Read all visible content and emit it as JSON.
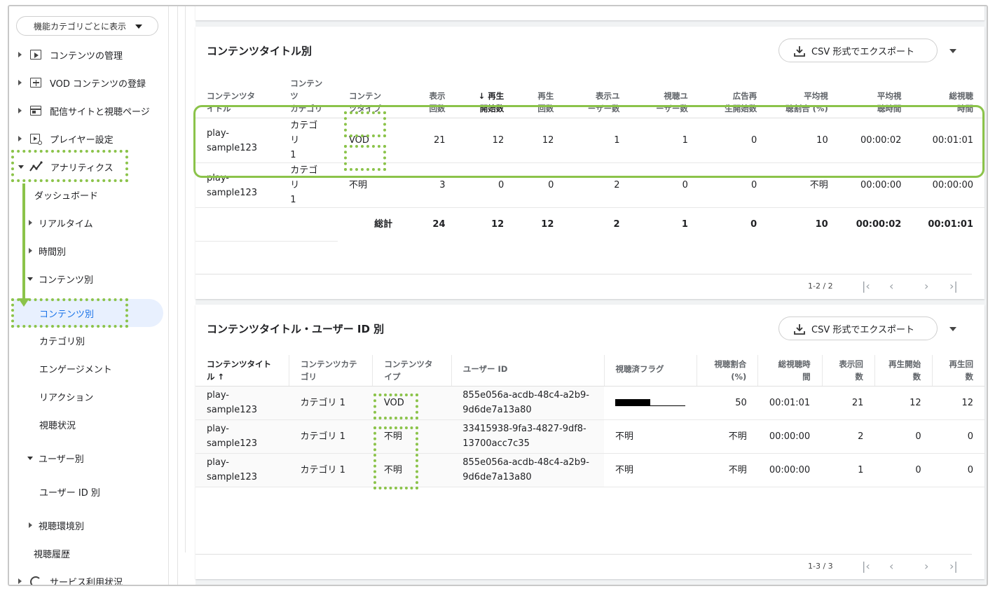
{
  "sidebar": {
    "select_label": "機能カテゴリごとに表示",
    "items": [
      {
        "label": "コンテンツの管理",
        "icon": "play-box-icon"
      },
      {
        "label": "VOD コンテンツの登録",
        "icon": "add-box-icon"
      },
      {
        "label": "配信サイトと視聴ページ",
        "icon": "web-page-icon"
      },
      {
        "label": "プレイヤー設定",
        "icon": "player-settings-icon"
      },
      {
        "label": "アナリティクス",
        "icon": "analytics-icon"
      },
      {
        "label": "ダッシュボード"
      },
      {
        "label": "リアルタイム"
      },
      {
        "label": "時間別"
      },
      {
        "label": "コンテンツ別"
      },
      {
        "label": "コンテンツ別"
      },
      {
        "label": "カテゴリ別"
      },
      {
        "label": "エンゲージメント"
      },
      {
        "label": "リアクション"
      },
      {
        "label": "視聴状況"
      },
      {
        "label": "ユーザー別"
      },
      {
        "label": "ユーザー ID 別"
      },
      {
        "label": "視聴環境別"
      },
      {
        "label": "視聴履歴"
      },
      {
        "label": "サービス利用状況",
        "icon": "service-usage-icon"
      }
    ]
  },
  "card1": {
    "title": "コンテンツタイトル別",
    "csv_label": "CSV 形式でエクスポート",
    "headers": [
      [
        "コンテンツタ",
        "イトル"
      ],
      [
        "コンテンツ",
        "カテゴリ"
      ],
      [
        "コンテン",
        "ツタイプ"
      ],
      [
        "表示",
        "回数"
      ],
      [
        "↓ 再生",
        "開始数"
      ],
      [
        "再生",
        "回数"
      ],
      [
        "表示ユ",
        "ーザー数"
      ],
      [
        "視聴ユ",
        "ーザー数"
      ],
      [
        "広告再",
        "生開始数"
      ],
      [
        "平均視",
        "聴割合 (%)"
      ],
      [
        "平均視",
        "聴時間"
      ],
      [
        "総視聴",
        "時間"
      ]
    ],
    "rows": [
      [
        "play-",
        "sample123",
        "カテゴリ",
        "1",
        "VOD",
        "21",
        "12",
        "12",
        "1",
        "1",
        "0",
        "10",
        "00:00:02",
        "00:01:01"
      ],
      [
        "play-",
        "sample123",
        "カテゴリ",
        "1",
        "不明",
        "3",
        "0",
        "0",
        "2",
        "0",
        "0",
        "不明",
        "00:00:00",
        "00:00:00"
      ]
    ],
    "total": [
      "総計",
      "24",
      "12",
      "12",
      "2",
      "1",
      "0",
      "10",
      "00:00:02",
      "00:01:01"
    ],
    "pager": "1-2 / 2"
  },
  "card2": {
    "title": "コンテンツタイトル・ユーザー ID 別",
    "csv_label": "CSV 形式でエクスポート",
    "headers": [
      [
        "コンテンツタイト",
        "ル ↑"
      ],
      [
        "コンテンツカテ",
        "ゴリ"
      ],
      [
        "コンテンツタ",
        "イプ"
      ],
      [
        "ユーザー ID",
        ""
      ],
      [
        "視聴済フラグ",
        ""
      ],
      [
        "視聴割合",
        "(%)"
      ],
      [
        "総視聴時",
        "間"
      ],
      [
        "表示回",
        "数"
      ],
      [
        "再生開始",
        "数"
      ],
      [
        "再生回",
        "数"
      ]
    ],
    "rows": [
      [
        "play-sample123",
        "カテゴリ 1",
        "VOD",
        "855e056a-acdb-48c4-a2b9-",
        "9d6de7a13a80",
        "",
        "50",
        "00:01:01",
        "21",
        "12",
        "12"
      ],
      [
        "play-sample123",
        "カテゴリ 1",
        "不明",
        "33415938-9fa3-4827-9df8-",
        "13700acc7c35",
        "不明",
        "不明",
        "00:00:00",
        "2",
        "0",
        "0"
      ],
      [
        "play-sample123",
        "カテゴリ 1",
        "不明",
        "855e056a-acdb-48c4-a2b9-",
        "9d6de7a13a80",
        "不明",
        "不明",
        "00:00:00",
        "1",
        "0",
        "0"
      ]
    ],
    "progress_fraction": 0.5,
    "pager": "1-3 / 3"
  },
  "colors": {
    "highlight": "#8bc34a",
    "active_bg": "#e8f0fe",
    "active_text": "#1a73e8"
  }
}
